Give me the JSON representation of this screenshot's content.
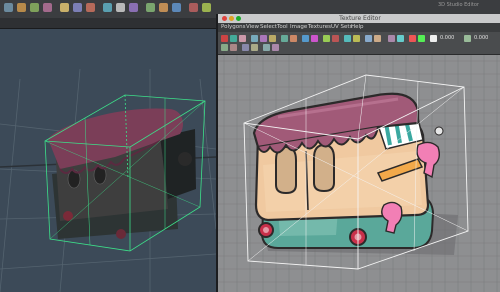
{
  "main_window": {
    "title": "3D Studio Editor"
  },
  "uv_editor": {
    "title": "Texture Editor",
    "menu": [
      "Polygons",
      "View",
      "Select",
      "Tool",
      "Image",
      "Textures",
      "UV Sets",
      "Help"
    ],
    "toolbar": {
      "value_1": "0.000",
      "value_2": "0.000"
    }
  },
  "colors": {
    "viewport_bg": "#3c4a58",
    "uv_canvas_bg": "#8e8f91",
    "roof": "#a15a78",
    "body": "#f0c9a0",
    "base": "#5aa89a",
    "wheel": "#c8304a",
    "selection_green": "#3de08a"
  }
}
